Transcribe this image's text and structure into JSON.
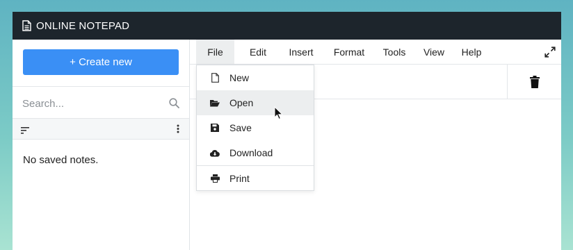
{
  "app": {
    "title": "ONLINE NOTEPAD"
  },
  "sidebar": {
    "create_label": "+ Create new",
    "search_placeholder": "Search...",
    "empty_message": "No saved notes."
  },
  "menubar": {
    "items": [
      {
        "label": "File",
        "active": true
      },
      {
        "label": "Edit"
      },
      {
        "label": "Insert"
      },
      {
        "label": "Format"
      },
      {
        "label": "Tools"
      },
      {
        "label": "View"
      },
      {
        "label": "Help"
      }
    ]
  },
  "file_menu": {
    "items": [
      {
        "label": "New",
        "icon": "file-icon"
      },
      {
        "label": "Open",
        "icon": "folder-open-icon",
        "hover": true
      },
      {
        "label": "Save",
        "icon": "save-icon"
      },
      {
        "label": "Download",
        "icon": "cloud-download-icon"
      },
      {
        "label": "Print",
        "icon": "print-icon"
      }
    ]
  },
  "colors": {
    "titlebar": "#1d252c",
    "accent": "#3a8ff5"
  }
}
